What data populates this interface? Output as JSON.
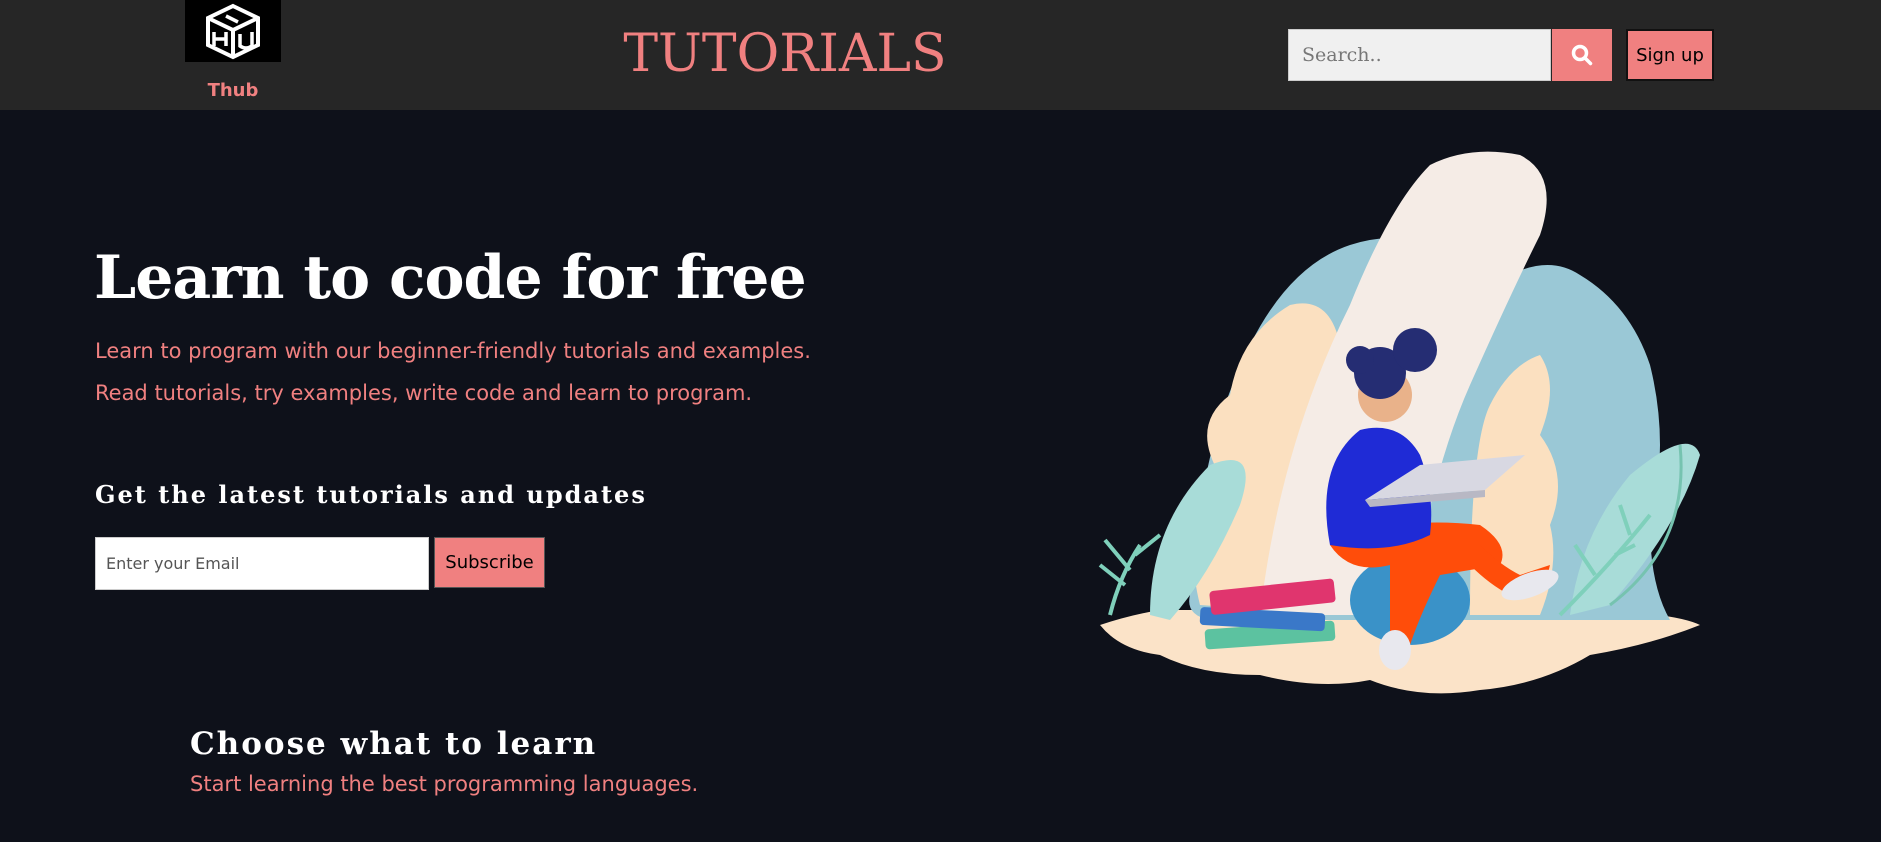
{
  "header": {
    "logo_text": "Thub",
    "logo_icon": "cube-logo-icon",
    "title": "TUTORIALS",
    "search_placeholder": "Search..",
    "search_icon": "search-icon",
    "signup_label": "Sign up"
  },
  "hero": {
    "title": "Learn to code for free",
    "subtitle_line1": "Learn to program with our beginner-friendly tutorials and examples.",
    "subtitle_line2": "Read tutorials, try examples, write code and learn to program."
  },
  "newsletter": {
    "title": "Get the latest tutorials and updates",
    "email_placeholder": "Enter your Email",
    "subscribe_label": "Subscribe"
  },
  "section": {
    "title": "Choose what to learn",
    "subtitle": "Start learning the best programming languages."
  },
  "colors": {
    "accent": "#f08080",
    "header_bg": "#262626",
    "page_bg": "#0e111a"
  }
}
